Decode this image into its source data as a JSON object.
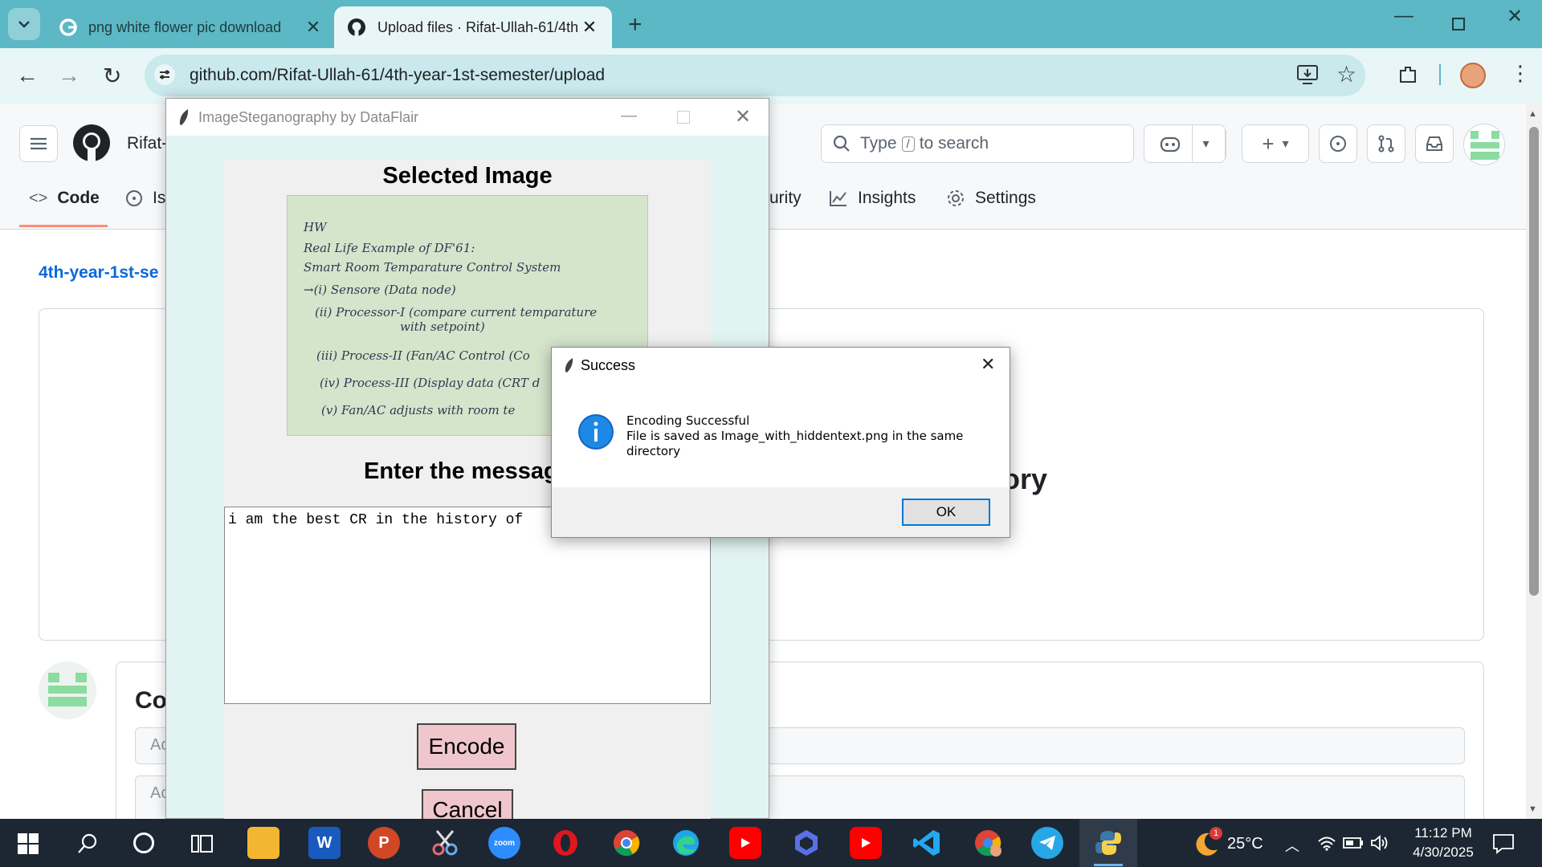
{
  "browser": {
    "tabs": [
      {
        "title": "png white flower pic download",
        "icon": "google-icon",
        "active": false
      },
      {
        "title": "Upload files · Rifat-Ullah-61/4th",
        "icon": "github-icon",
        "active": true
      }
    ],
    "url": "github.com/Rifat-Ullah-61/4th-year-1st-semester/upload"
  },
  "github": {
    "owner_fragment": "Rifat-",
    "search_prefix": "Type",
    "search_key": "/",
    "search_suffix": "to search",
    "tabs": {
      "code": "Code",
      "issues_fragment": "Is",
      "security_fragment": "urity",
      "insights": "Insights",
      "settings": "Settings"
    },
    "breadcrumb_fragment": "4th-year-1st-se",
    "drop_heading_fragment": "tory",
    "commit_heading_fragment": "Co",
    "input_fragment_1": "Ac",
    "input_fragment_2": "Ac"
  },
  "app": {
    "title": "ImageSteganography by DataFlair",
    "selected_heading": "Selected Image",
    "note_lines": [
      "HW",
      "Real Life Example of DF'61:",
      "Smart Room Temparature Control System",
      "→(i) Sensore (Data node)",
      "(ii) Processor-I (compare current temparature",
      "with setpoint)",
      "(iii) Process-II (Fan/AC Control (Co",
      "(iv) Process-III (Display data (CRT d",
      "(v) Fan/AC adjusts with room te"
    ],
    "message_heading": "Enter the messag",
    "message_text": "i am the best CR in the history of",
    "encode_label": "Encode",
    "cancel_label": "Cancel"
  },
  "dialog": {
    "title": "Success",
    "line1": "Encoding Successful",
    "line2": "File is saved as Image_with_hiddentext.png in the same",
    "line3": "directory",
    "ok_label": "OK"
  },
  "taskbar": {
    "apps": [
      "windows-start",
      "search",
      "cortana",
      "task-view",
      "file-explorer",
      "word",
      "powerpoint",
      "snipping-tool",
      "zoom",
      "opera",
      "chrome",
      "edge",
      "youtube",
      "copilot",
      "youtube-2",
      "vscode",
      "chrome-profile",
      "telegram",
      "python"
    ],
    "zoom_label": "zoom",
    "word_label": "W",
    "ppt_label": "P",
    "weather_badge": "1",
    "temperature": "25°C",
    "time": "11:12 PM",
    "date": "4/30/2025"
  },
  "colors": {
    "tabstrip": "#5bb8c4",
    "toolbar": "#e9f6f7",
    "github_link": "#0969da",
    "tab_underline": "#fd8c73",
    "app_bg": "#e2f4f1",
    "button_pink": "#efc6cb",
    "dialog_accent": "#0078d7",
    "taskbar": "#1c2733"
  }
}
